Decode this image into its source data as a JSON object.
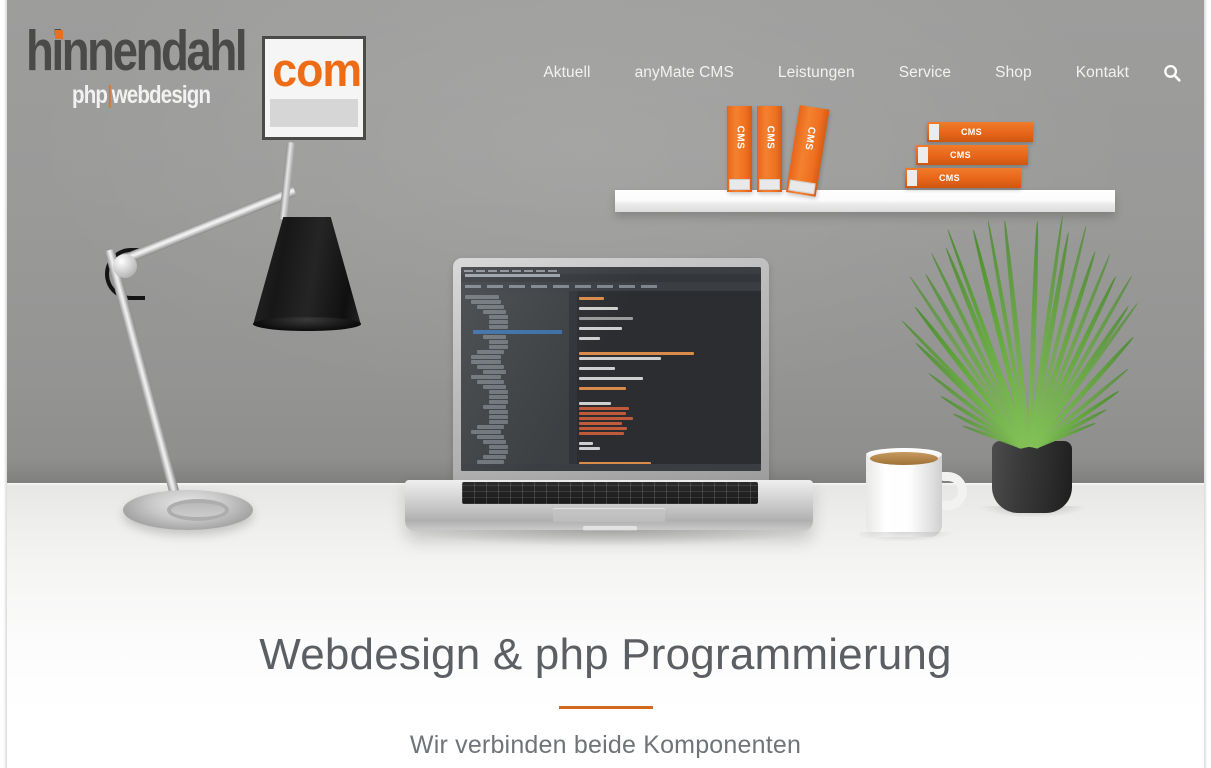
{
  "site": {
    "logo": {
      "word": "hinnendahl",
      "tagline_left": "php",
      "tagline_sep": "|",
      "tagline_right": "webdesign",
      "box_text": "com",
      "dot_color": "#e8701a",
      "word_color": "#4a4a48",
      "com_color": "#ef6c16"
    },
    "nav": {
      "items": [
        {
          "label": "Aktuell"
        },
        {
          "label": "anyMate CMS"
        },
        {
          "label": "Leistungen"
        },
        {
          "label": "Service"
        },
        {
          "label": "Shop"
        },
        {
          "label": "Kontakt"
        }
      ],
      "search_icon": "search-icon"
    }
  },
  "hero": {
    "headline": "Webdesign & php Programmierung",
    "subheadline": "Wir verbinden beide Komponenten",
    "divider_color": "#d2691e",
    "headline_color": "#5b5f63"
  },
  "scene": {
    "wall_color": "#9a9a99",
    "desk_color": "#ffffff",
    "shelf": {
      "name": "wall-shelf",
      "color": "#ffffff"
    },
    "books_standing": [
      {
        "spine_text": "CMS"
      },
      {
        "spine_text": "CMS"
      },
      {
        "spine_text": "CMS"
      }
    ],
    "books_stacked": [
      {
        "spine_text": "CMS"
      },
      {
        "spine_text": "CMS"
      },
      {
        "spine_text": "CMS"
      }
    ],
    "book_color": "#e8651a",
    "lamp": {
      "name": "desk-lamp",
      "shade_color": "#171717",
      "arm_color": "#cfcfcf"
    },
    "laptop": {
      "name": "laptop",
      "body_color": "#c4c4c4",
      "screen_color": "#2b2d30"
    },
    "mug": {
      "name": "coffee-mug",
      "color": "#ffffff",
      "coffee_color": "#9e7238"
    },
    "plant": {
      "name": "potted-grass-plant",
      "pot_color": "#2e2e2e",
      "leaf_color": "#62a83b"
    }
  }
}
